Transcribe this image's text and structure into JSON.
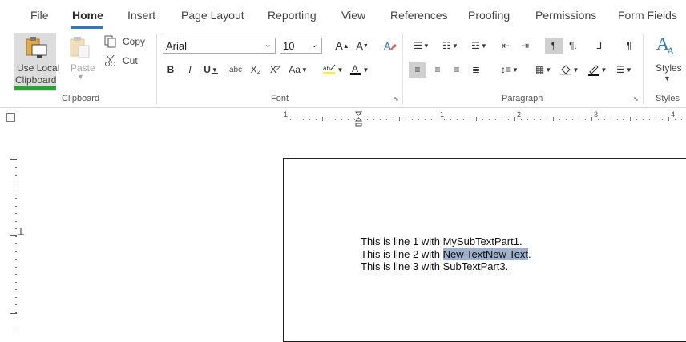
{
  "tabs": [
    "File",
    "Home",
    "Insert",
    "Page Layout",
    "Reporting",
    "View",
    "References",
    "Proofing",
    "Permissions",
    "Form Fields"
  ],
  "active_tab": "Home",
  "clipboard": {
    "use_local_line1": "Use Local",
    "use_local_line2": "Clipboard",
    "paste": "Paste",
    "copy": "Copy",
    "cut": "Cut",
    "group_label": "Clipboard"
  },
  "font": {
    "family": "Arial",
    "size": "10",
    "group_label": "Font",
    "bold": "B",
    "italic": "I",
    "underline": "U",
    "strike": "abc",
    "subscript": "X₂",
    "superscript": "X²",
    "change_case": "Aa"
  },
  "paragraph": {
    "group_label": "Paragraph"
  },
  "styles": {
    "label": "Styles",
    "group_label": "Styles"
  },
  "ruler": {
    "numbers": [
      "1",
      "1",
      "2",
      "3",
      "4"
    ]
  },
  "document": {
    "line1": "This is line 1 with MySubTextPart1.",
    "line2_prefix": "This is line 2 with ",
    "line2_selected": "New TextNew Text",
    "line2_suffix": ".",
    "line3": "This is line 3 with SubTextPart3."
  },
  "colors": {
    "accent": "#2b79c2",
    "clipboard_active": "#29a535",
    "selection": "#9fb0cc"
  }
}
